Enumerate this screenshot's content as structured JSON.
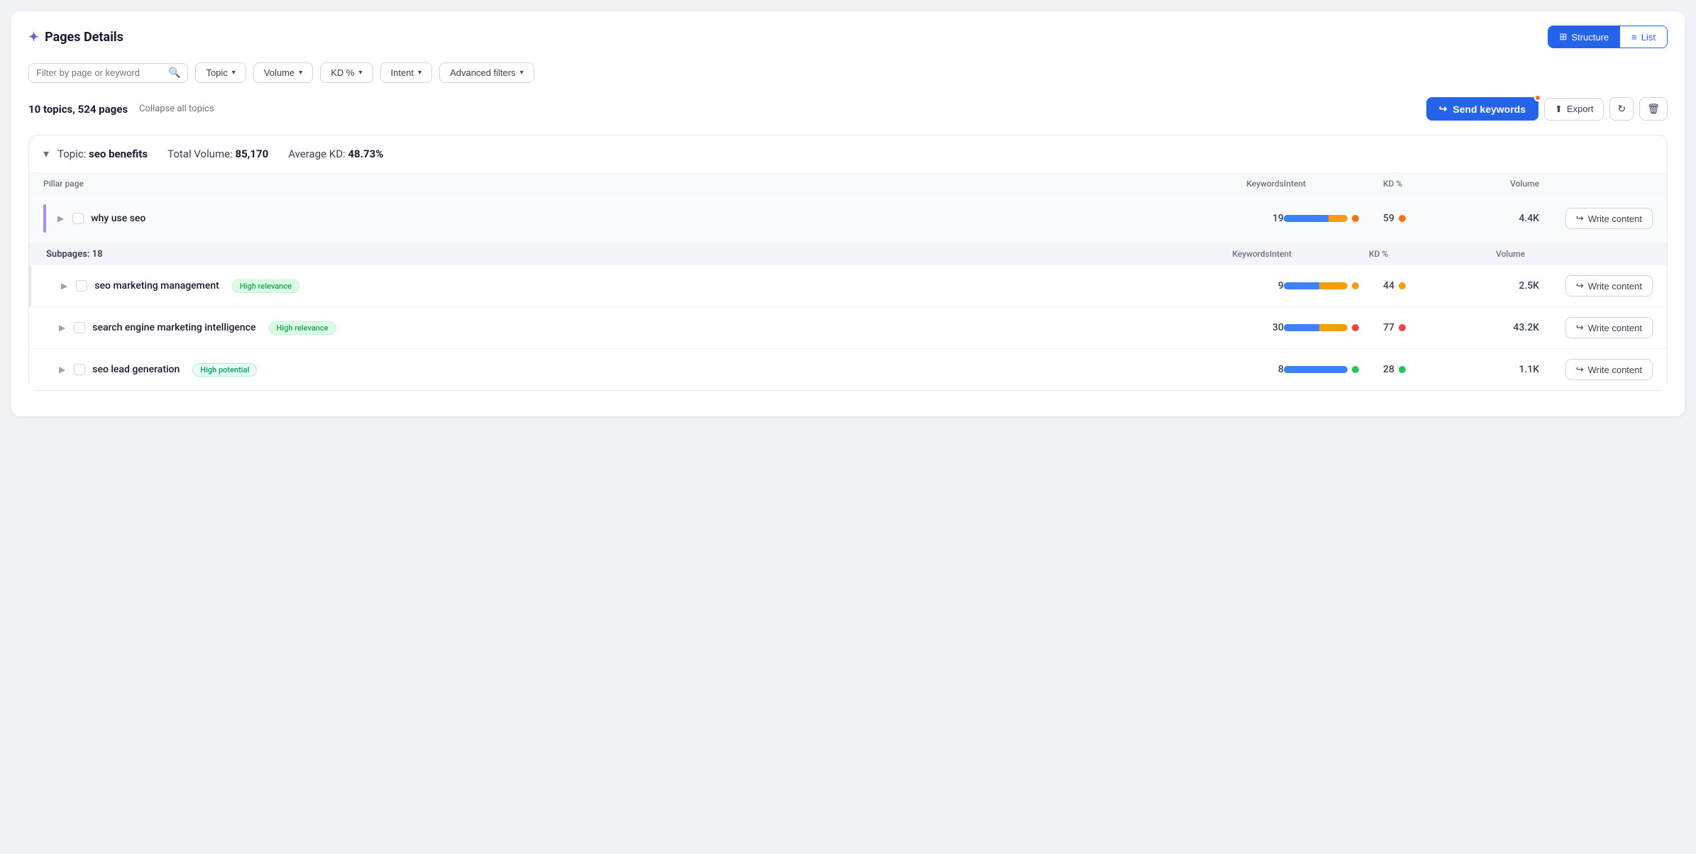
{
  "header": {
    "title": "Pages Details",
    "spark": "✦",
    "view_structure": "Structure",
    "view_list": "List",
    "active_view": "structure"
  },
  "filters": {
    "search_placeholder": "Filter by page or keyword",
    "topic_label": "Topic",
    "volume_label": "Volume",
    "kd_label": "KD %",
    "intent_label": "Intent",
    "advanced_label": "Advanced filters"
  },
  "summary": {
    "topics_count": "10 topics, 524 pages",
    "collapse_label": "Collapse all topics",
    "send_label": "Send keywords",
    "export_label": "Export"
  },
  "topic": {
    "prefix": "Topic:",
    "name": "seo benefits",
    "volume_label": "Total Volume:",
    "volume_value": "85,170",
    "kd_label": "Average KD:",
    "kd_value": "48.73%"
  },
  "table": {
    "pillar_col": "Pillar page",
    "subpages_label": "Subpages: 18",
    "keywords_col": "Keywords",
    "intent_col": "Intent",
    "kd_col": "KD %",
    "volume_col": "Volume",
    "action_col": "",
    "pillar_row": {
      "name": "why use seo",
      "keywords": "19",
      "kd": "59",
      "kd_dot": "#f97316",
      "volume": "4.4K",
      "write_label": "Write content",
      "has_notif": true,
      "intent_blue": 70,
      "intent_yellow": 30
    },
    "sub_rows": [
      {
        "name": "seo marketing management",
        "badge": "High relevance",
        "badge_type": "relevance",
        "keywords": "9",
        "kd": "44",
        "kd_dot": "#f59e0b",
        "volume": "2.5K",
        "write_label": "Write content",
        "has_notif": false,
        "intent_blue": 55,
        "intent_yellow": 45
      },
      {
        "name": "search engine marketing intelligence",
        "badge": "High relevance",
        "badge_type": "relevance",
        "keywords": "30",
        "kd": "77",
        "kd_dot": "#ef4444",
        "volume": "43.2K",
        "write_label": "Write content",
        "has_notif": false,
        "intent_blue": 55,
        "intent_yellow": 45
      },
      {
        "name": "seo lead generation",
        "badge": "High potential",
        "badge_type": "potential",
        "keywords": "8",
        "kd": "28",
        "kd_dot": "#22c55e",
        "volume": "1.1K",
        "write_label": "Write content",
        "has_notif": false,
        "intent_blue": 100,
        "intent_yellow": 0
      }
    ]
  }
}
